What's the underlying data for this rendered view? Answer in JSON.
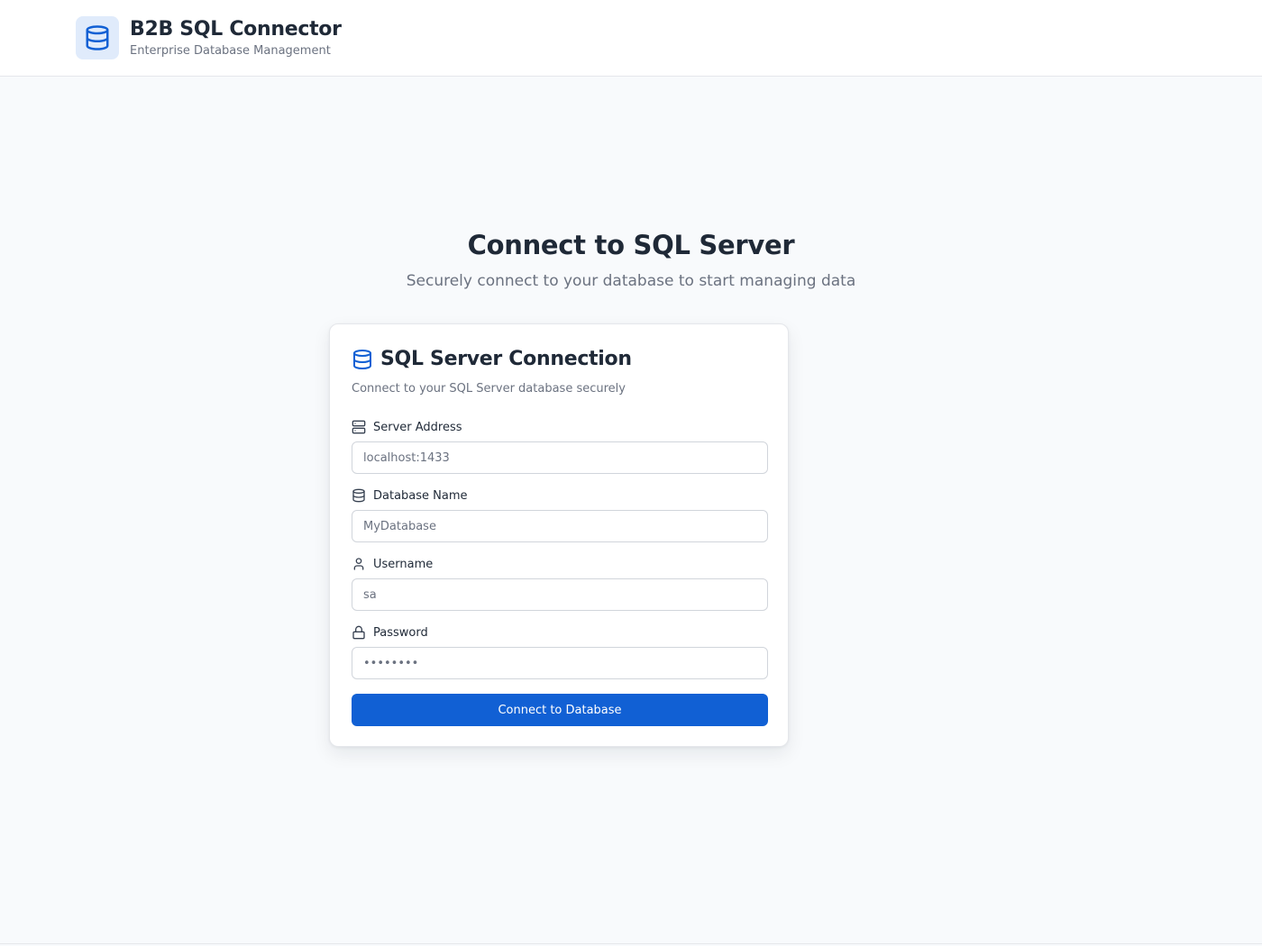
{
  "header": {
    "title": "B2B SQL Connector",
    "subtitle": "Enterprise Database Management",
    "logo_icon": "database-icon"
  },
  "hero": {
    "title": "Connect to SQL Server",
    "subtitle": "Securely connect to your database to start managing data"
  },
  "card": {
    "title": "SQL Server Connection",
    "description": "Connect to your SQL Server database securely",
    "title_icon": "database-icon",
    "fields": [
      {
        "label": "Server Address",
        "icon": "server-icon",
        "value": "localhost:1433",
        "type": "text"
      },
      {
        "label": "Database Name",
        "icon": "database-icon",
        "value": "MyDatabase",
        "type": "text"
      },
      {
        "label": "Username",
        "icon": "user-icon",
        "value": "sa",
        "type": "text"
      },
      {
        "label": "Password",
        "icon": "lock-icon",
        "value": "••••••••",
        "type": "password"
      }
    ],
    "submit_label": "Connect to Database"
  },
  "colors": {
    "accent": "#1160d4",
    "background": "#f8fafc",
    "text": "#1f2937",
    "muted": "#6b7280"
  }
}
